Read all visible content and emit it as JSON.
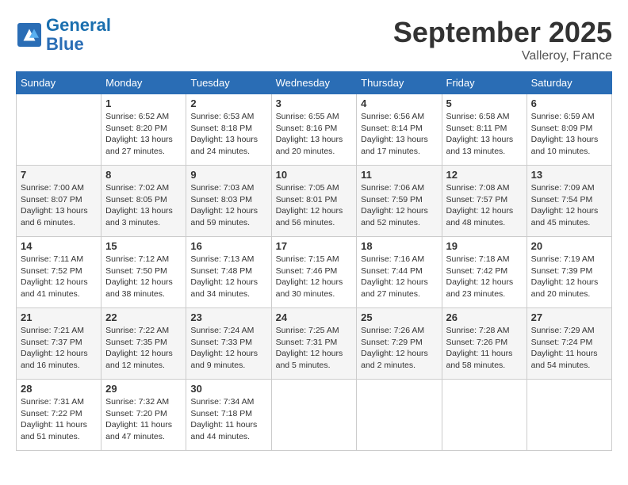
{
  "header": {
    "logo_line1": "General",
    "logo_line2": "Blue",
    "month": "September 2025",
    "location": "Valleroy, France"
  },
  "days_of_week": [
    "Sunday",
    "Monday",
    "Tuesday",
    "Wednesday",
    "Thursday",
    "Friday",
    "Saturday"
  ],
  "weeks": [
    [
      {
        "day": "",
        "info": ""
      },
      {
        "day": "1",
        "info": "Sunrise: 6:52 AM\nSunset: 8:20 PM\nDaylight: 13 hours\nand 27 minutes."
      },
      {
        "day": "2",
        "info": "Sunrise: 6:53 AM\nSunset: 8:18 PM\nDaylight: 13 hours\nand 24 minutes."
      },
      {
        "day": "3",
        "info": "Sunrise: 6:55 AM\nSunset: 8:16 PM\nDaylight: 13 hours\nand 20 minutes."
      },
      {
        "day": "4",
        "info": "Sunrise: 6:56 AM\nSunset: 8:14 PM\nDaylight: 13 hours\nand 17 minutes."
      },
      {
        "day": "5",
        "info": "Sunrise: 6:58 AM\nSunset: 8:11 PM\nDaylight: 13 hours\nand 13 minutes."
      },
      {
        "day": "6",
        "info": "Sunrise: 6:59 AM\nSunset: 8:09 PM\nDaylight: 13 hours\nand 10 minutes."
      }
    ],
    [
      {
        "day": "7",
        "info": "Sunrise: 7:00 AM\nSunset: 8:07 PM\nDaylight: 13 hours\nand 6 minutes."
      },
      {
        "day": "8",
        "info": "Sunrise: 7:02 AM\nSunset: 8:05 PM\nDaylight: 13 hours\nand 3 minutes."
      },
      {
        "day": "9",
        "info": "Sunrise: 7:03 AM\nSunset: 8:03 PM\nDaylight: 12 hours\nand 59 minutes."
      },
      {
        "day": "10",
        "info": "Sunrise: 7:05 AM\nSunset: 8:01 PM\nDaylight: 12 hours\nand 56 minutes."
      },
      {
        "day": "11",
        "info": "Sunrise: 7:06 AM\nSunset: 7:59 PM\nDaylight: 12 hours\nand 52 minutes."
      },
      {
        "day": "12",
        "info": "Sunrise: 7:08 AM\nSunset: 7:57 PM\nDaylight: 12 hours\nand 48 minutes."
      },
      {
        "day": "13",
        "info": "Sunrise: 7:09 AM\nSunset: 7:54 PM\nDaylight: 12 hours\nand 45 minutes."
      }
    ],
    [
      {
        "day": "14",
        "info": "Sunrise: 7:11 AM\nSunset: 7:52 PM\nDaylight: 12 hours\nand 41 minutes."
      },
      {
        "day": "15",
        "info": "Sunrise: 7:12 AM\nSunset: 7:50 PM\nDaylight: 12 hours\nand 38 minutes."
      },
      {
        "day": "16",
        "info": "Sunrise: 7:13 AM\nSunset: 7:48 PM\nDaylight: 12 hours\nand 34 minutes."
      },
      {
        "day": "17",
        "info": "Sunrise: 7:15 AM\nSunset: 7:46 PM\nDaylight: 12 hours\nand 30 minutes."
      },
      {
        "day": "18",
        "info": "Sunrise: 7:16 AM\nSunset: 7:44 PM\nDaylight: 12 hours\nand 27 minutes."
      },
      {
        "day": "19",
        "info": "Sunrise: 7:18 AM\nSunset: 7:42 PM\nDaylight: 12 hours\nand 23 minutes."
      },
      {
        "day": "20",
        "info": "Sunrise: 7:19 AM\nSunset: 7:39 PM\nDaylight: 12 hours\nand 20 minutes."
      }
    ],
    [
      {
        "day": "21",
        "info": "Sunrise: 7:21 AM\nSunset: 7:37 PM\nDaylight: 12 hours\nand 16 minutes."
      },
      {
        "day": "22",
        "info": "Sunrise: 7:22 AM\nSunset: 7:35 PM\nDaylight: 12 hours\nand 12 minutes."
      },
      {
        "day": "23",
        "info": "Sunrise: 7:24 AM\nSunset: 7:33 PM\nDaylight: 12 hours\nand 9 minutes."
      },
      {
        "day": "24",
        "info": "Sunrise: 7:25 AM\nSunset: 7:31 PM\nDaylight: 12 hours\nand 5 minutes."
      },
      {
        "day": "25",
        "info": "Sunrise: 7:26 AM\nSunset: 7:29 PM\nDaylight: 12 hours\nand 2 minutes."
      },
      {
        "day": "26",
        "info": "Sunrise: 7:28 AM\nSunset: 7:26 PM\nDaylight: 11 hours\nand 58 minutes."
      },
      {
        "day": "27",
        "info": "Sunrise: 7:29 AM\nSunset: 7:24 PM\nDaylight: 11 hours\nand 54 minutes."
      }
    ],
    [
      {
        "day": "28",
        "info": "Sunrise: 7:31 AM\nSunset: 7:22 PM\nDaylight: 11 hours\nand 51 minutes."
      },
      {
        "day": "29",
        "info": "Sunrise: 7:32 AM\nSunset: 7:20 PM\nDaylight: 11 hours\nand 47 minutes."
      },
      {
        "day": "30",
        "info": "Sunrise: 7:34 AM\nSunset: 7:18 PM\nDaylight: 11 hours\nand 44 minutes."
      },
      {
        "day": "",
        "info": ""
      },
      {
        "day": "",
        "info": ""
      },
      {
        "day": "",
        "info": ""
      },
      {
        "day": "",
        "info": ""
      }
    ]
  ]
}
